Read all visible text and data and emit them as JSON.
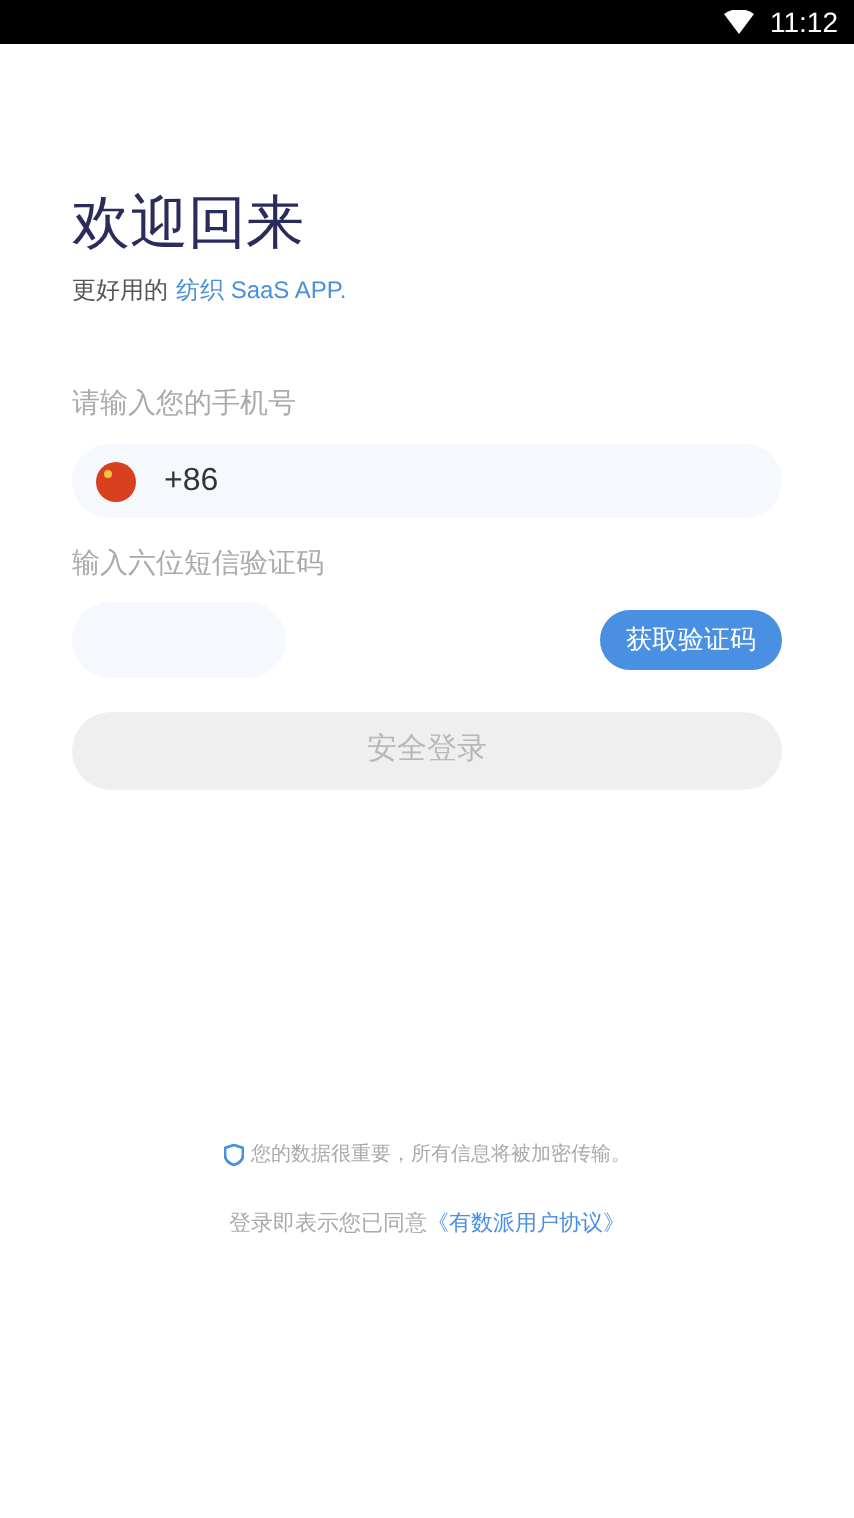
{
  "status_bar": {
    "time": "11:12"
  },
  "heading": "欢迎回来",
  "subtitle": {
    "text": "更好用的",
    "highlight": "纺织 SaaS APP."
  },
  "phone": {
    "label": "请输入您的手机号",
    "country_code": "+86"
  },
  "code": {
    "label": "输入六位短信验证码",
    "button": "获取验证码"
  },
  "login_button": {
    "label": "安全登录",
    "disabled": true
  },
  "security_note": "您的数据很重要，所有信息将被加密传输。",
  "agreement": {
    "text": "登录即表示您已同意",
    "link": "《有数派用户协议》"
  }
}
